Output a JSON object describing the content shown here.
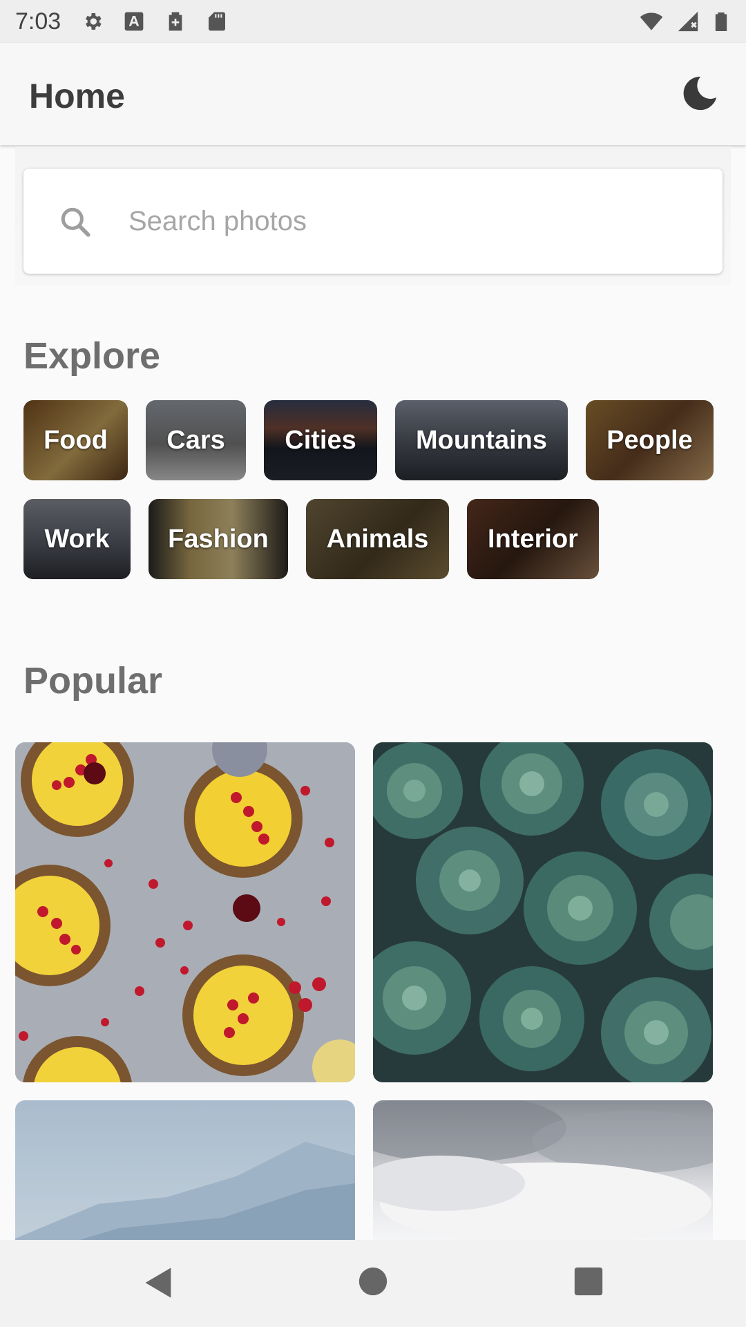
{
  "status_bar": {
    "time": "7:03",
    "icons_left": [
      "settings-icon",
      "font-a-icon",
      "medical-plus-icon",
      "sd-card-icon"
    ],
    "icons_right": [
      "wifi-icon",
      "signal-icon",
      "battery-icon"
    ]
  },
  "app_bar": {
    "title": "Home",
    "action_icon": "moon-icon"
  },
  "search": {
    "placeholder": "Search photos",
    "value": ""
  },
  "explore": {
    "title": "Explore",
    "chips": [
      {
        "label": "Food",
        "color": "#7a5a2e"
      },
      {
        "label": "Cars",
        "color": "#8a8a8a"
      },
      {
        "label": "Cities",
        "color": "#2a3446"
      },
      {
        "label": "Mountains",
        "color": "#5b6170"
      },
      {
        "label": "People",
        "color": "#6b4a2c"
      },
      {
        "label": "Work",
        "color": "#5a5e68"
      },
      {
        "label": "Fashion",
        "color": "#9a8450"
      },
      {
        "label": "Animals",
        "color": "#6f5a3a"
      },
      {
        "label": "Interior",
        "color": "#5a3a2a"
      }
    ]
  },
  "popular": {
    "title": "Popular",
    "photos": [
      {
        "subject": "lemon tarts with red currants",
        "color": "#a9adb4"
      },
      {
        "subject": "succulent plants",
        "color": "#3e5a52"
      },
      {
        "subject": "misty mountains",
        "color": "#b6c6d4"
      },
      {
        "subject": "clouds",
        "color": "#c9cbcf"
      }
    ]
  },
  "nav_bar": {
    "icons": [
      "back-triangle-icon",
      "home-circle-icon",
      "recents-square-icon"
    ]
  }
}
